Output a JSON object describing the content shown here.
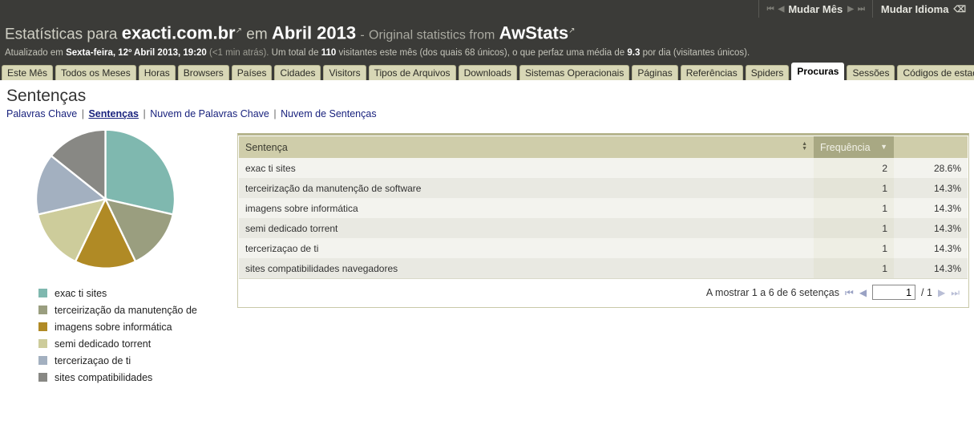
{
  "topbar": {
    "month_switcher": {
      "label": "Mudar Mês",
      "first_icon": "first-page-icon",
      "prev_icon": "prev-page-icon",
      "next_icon": "next-page-icon",
      "last_icon": "last-page-icon"
    },
    "language_switcher": {
      "label": "Mudar Idioma",
      "icon": "flag-icon"
    }
  },
  "header": {
    "title_prefix": "Estatísticas para",
    "site": "exacti.com.br",
    "title_middle": "em",
    "period": "Abril 2013",
    "dash": "-",
    "original_text": "Original statistics from",
    "source": "AwStats",
    "external_icon": "external-link-icon",
    "subtitle": {
      "updated_label": "Atualizado em",
      "updated_value": "Sexta-feira, 12º Abril 2013, 19:20",
      "ago": "(<1 min atrás).",
      "total_label": "Um total de",
      "total_value": "110",
      "visitors_text": "visitantes este mês (dos quais 68 únicos), o que perfaz uma média de",
      "average_value": "9.3",
      "average_suffix": "por dia (visitantes únicos)."
    }
  },
  "tabs": [
    {
      "label": "Este Mês",
      "active": false
    },
    {
      "label": "Todos os Meses",
      "active": false
    },
    {
      "label": "Horas",
      "active": false
    },
    {
      "label": "Browsers",
      "active": false
    },
    {
      "label": "Países",
      "active": false
    },
    {
      "label": "Cidades",
      "active": false
    },
    {
      "label": "Visitors",
      "active": false
    },
    {
      "label": "Tipos de Arquivos",
      "active": false
    },
    {
      "label": "Downloads",
      "active": false
    },
    {
      "label": "Sistemas Operacionais",
      "active": false
    },
    {
      "label": "Páginas",
      "active": false
    },
    {
      "label": "Referências",
      "active": false
    },
    {
      "label": "Spiders",
      "active": false
    },
    {
      "label": "Procuras",
      "active": true
    },
    {
      "label": "Sessões",
      "active": false
    },
    {
      "label": "Códigos de estado",
      "active": false
    }
  ],
  "page": {
    "title": "Sentenças",
    "subnav": [
      {
        "label": "Palavras Chave",
        "current": false
      },
      {
        "label": "Sentenças",
        "current": true
      },
      {
        "label": "Nuvem de Palavras Chave",
        "current": false
      },
      {
        "label": "Nuvem de Sentenças",
        "current": false
      }
    ],
    "subnav_separator": "|"
  },
  "table": {
    "columns": [
      {
        "label": "Sentença",
        "sorted": false,
        "sort_icon": "sort-both-icon"
      },
      {
        "label": "Frequência",
        "sorted": true,
        "sort_icon": "sort-desc-icon"
      },
      {
        "label": "",
        "sorted": false,
        "sort_icon": ""
      }
    ],
    "rows": [
      {
        "sentence": "exac ti sites",
        "frequency": "2",
        "percent": "28.6%"
      },
      {
        "sentence": "terceirização da manutenção de software",
        "frequency": "1",
        "percent": "14.3%"
      },
      {
        "sentence": "imagens sobre informática",
        "frequency": "1",
        "percent": "14.3%"
      },
      {
        "sentence": "semi dedicado torrent",
        "frequency": "1",
        "percent": "14.3%"
      },
      {
        "sentence": "tercerizaçao de ti",
        "frequency": "1",
        "percent": "14.3%"
      },
      {
        "sentence": "sites compatibilidades navegadores",
        "frequency": "1",
        "percent": "14.3%"
      }
    ],
    "footer": {
      "summary": "A mostrar 1 a 6 de 6 setenças",
      "first_icon": "first-page-icon",
      "prev_icon": "prev-page-icon",
      "current_page": "1",
      "page_total": "/ 1",
      "next_icon": "next-page-icon",
      "last_icon": "last-page-icon"
    }
  },
  "chart_data": {
    "type": "pie",
    "title": "Sentenças",
    "categories": [
      "exac ti sites",
      "terceirização da manutenção de",
      "imagens sobre informática",
      "semi dedicado torrent",
      "tercerizaçao de ti",
      "sites compatibilidades"
    ],
    "values": [
      28.6,
      14.3,
      14.3,
      14.3,
      14.3,
      14.3
    ],
    "counts": [
      2,
      1,
      1,
      1,
      1,
      1
    ],
    "colors": [
      "#7fb8af",
      "#9a9e7f",
      "#b08a25",
      "#cdcc9b",
      "#a3b0c0",
      "#888884"
    ],
    "legend_position": "bottom-left",
    "unit": "%"
  }
}
